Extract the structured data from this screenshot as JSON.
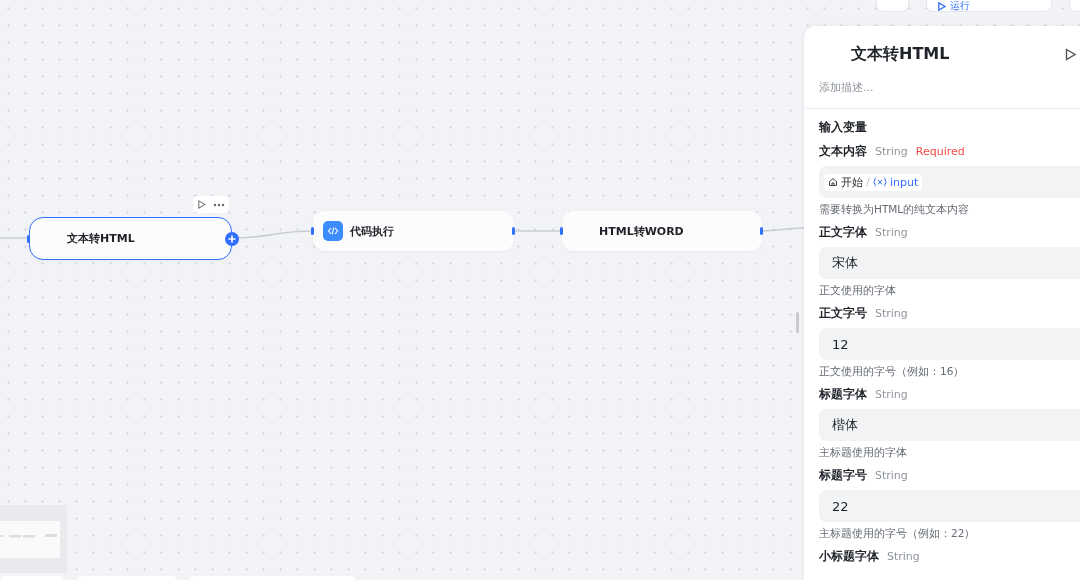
{
  "toolbar": {
    "run_label": "运行"
  },
  "nodes": [
    {
      "title": "文本转HTML",
      "kind": "plain",
      "selected": true
    },
    {
      "title": "代码执行",
      "kind": "code",
      "selected": false
    },
    {
      "title": "HTML转WORD",
      "kind": "plain",
      "selected": false
    }
  ],
  "panel": {
    "title": "文本转HTML",
    "description_placeholder": "添加描述...",
    "section_title": "输入变量",
    "params": [
      {
        "name": "文本内容",
        "type": "String",
        "required_label": "Required",
        "kind": "reference",
        "source": "开始",
        "variable": "input",
        "hint": "需要转换为HTML的纯文本内容"
      },
      {
        "name": "正文字体",
        "type": "String",
        "kind": "text",
        "value": "宋体",
        "hint": "正文使用的字体"
      },
      {
        "name": "正文字号",
        "type": "String",
        "kind": "text",
        "value": "12",
        "hint": "正文使用的字号（例如：16）"
      },
      {
        "name": "标题字体",
        "type": "String",
        "kind": "text",
        "value": "楷体",
        "hint": "主标题使用的字体"
      },
      {
        "name": "标题字号",
        "type": "String",
        "kind": "text",
        "value": "22",
        "hint": "主标题使用的字号（例如：22）"
      },
      {
        "name": "小标题字体",
        "type": "String"
      }
    ]
  }
}
